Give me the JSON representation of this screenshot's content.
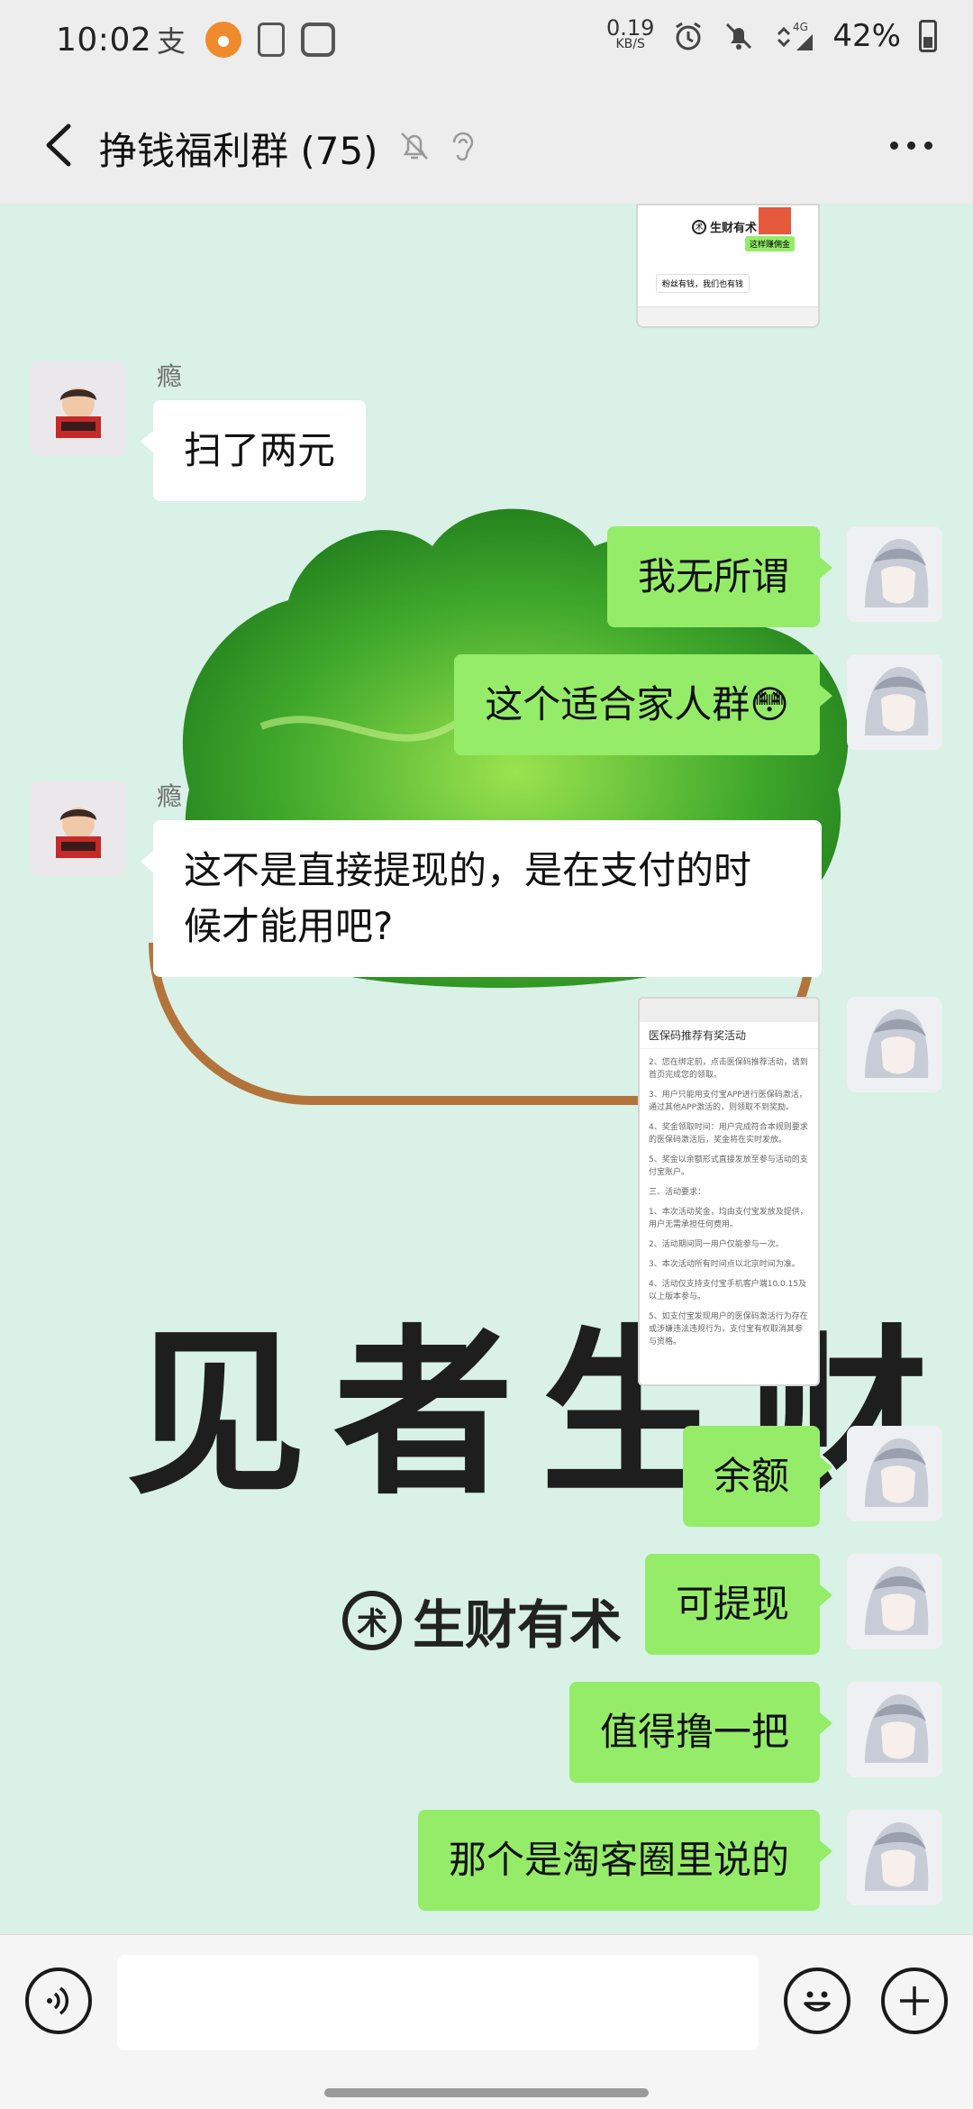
{
  "status_bar": {
    "time": "10:02",
    "net_speed_value": "0.19",
    "net_speed_unit": "KB/S",
    "signal": "4G",
    "battery": "42%"
  },
  "header": {
    "title": "挣钱福利群 (75)"
  },
  "background": {
    "calligraphy": "见者生财",
    "brand": "生财有术",
    "brand_logo": "术"
  },
  "messages": [
    {
      "side": "left",
      "nick": "瘾",
      "text": "扫了两元"
    },
    {
      "side": "right",
      "text": "我无所谓"
    },
    {
      "side": "right",
      "text": "这个适合家人群😳"
    },
    {
      "side": "left",
      "nick": "瘾",
      "text_line1": "这不是直接提现的，是在支付的时",
      "text_line2": "候才能用吧?"
    },
    {
      "side": "right",
      "image_title": "医保码推荐有奖活动"
    },
    {
      "side": "right",
      "text": "余额"
    },
    {
      "side": "right",
      "text": "可提现"
    },
    {
      "side": "right",
      "text": "值得撸一把"
    },
    {
      "side": "right",
      "text": "那个是淘客圈里说的"
    }
  ],
  "top_image": {
    "brand_text": "生财有术",
    "tag_text": "这样赚佣金",
    "chat_text": "粉丝有钱，我们也有钱"
  },
  "shot_lines": [
    "2、您在绑定前，点击医保码推荐活动，请到首页完成您的领取。",
    "3、用户只能用支付宝APP进行医保码激活，通过其他APP激活的，则领取不到奖励。",
    "4、奖金领取时间：用户完成符合本规则要求的医保码激活后，奖金将在实时发放。",
    "5、奖金以余额形式直接发放至参与活动的支付宝账户。",
    "三、活动要求：",
    "1、本次活动奖金，均由支付宝发放及提供，用户无需承担任何费用。",
    "2、活动期间同一用户仅能参与一次。",
    "3、本次活动所有时间点以北京时间为准。",
    "4、活动仅支持支付宝手机客户端10.0.15及以上版本参与。",
    "5、如支付宝发现用户的医保码激活行为存在或涉嫌违法违规行为，支付宝有权取消其参与资格。"
  ],
  "input": {
    "placeholder": ""
  },
  "colors": {
    "bubble_right": "#95ec69",
    "bubble_left": "#ffffff",
    "header_bg": "#ededed"
  }
}
